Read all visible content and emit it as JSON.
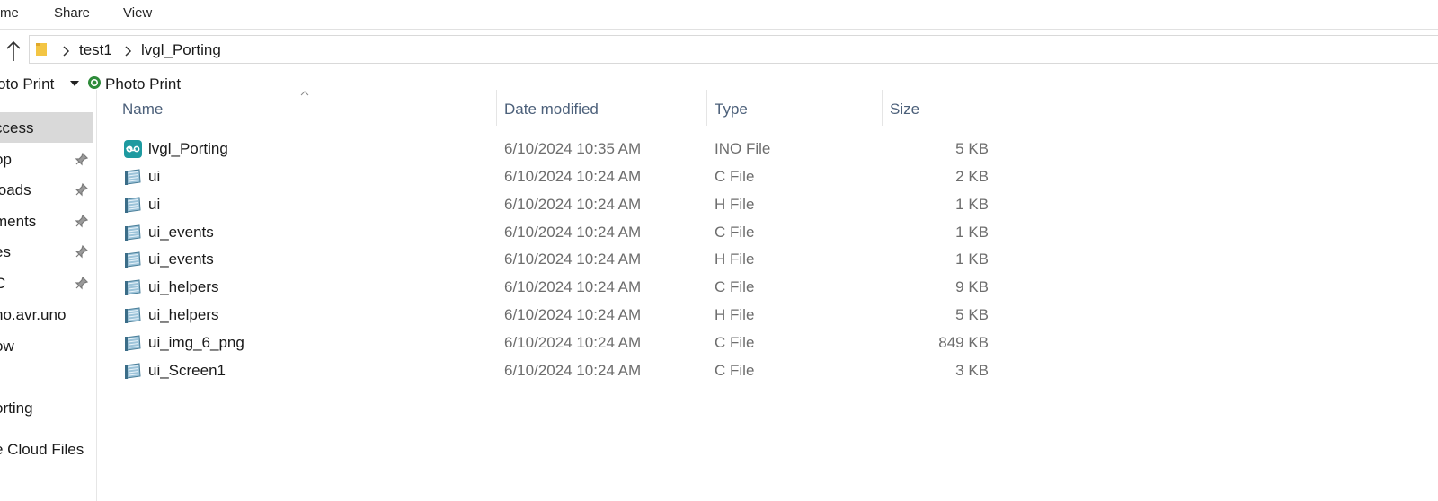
{
  "ribbon": {
    "tabs": [
      "me",
      "Share",
      "View"
    ]
  },
  "address": {
    "segments": [
      "test1",
      "lvgl_Porting"
    ]
  },
  "toolbar": {
    "item1": "oto Print",
    "item2": "Photo Print"
  },
  "nav": {
    "items": [
      {
        "label": "ccess",
        "pinned": false,
        "selected": true
      },
      {
        "label": "op",
        "pinned": true
      },
      {
        "label": "loads",
        "pinned": true
      },
      {
        "label": "ments",
        "pinned": true
      },
      {
        "label": "es",
        "pinned": true
      },
      {
        "label": "C",
        "pinned": true
      },
      {
        "label": "no.avr.uno",
        "pinned": false
      },
      {
        "label": "ow",
        "pinned": false
      },
      {
        "label": "orting",
        "pinned": false
      },
      {
        "label": "e Cloud Files",
        "pinned": false
      }
    ]
  },
  "columns": {
    "name": "Name",
    "date": "Date modified",
    "type": "Type",
    "size": "Size"
  },
  "files": [
    {
      "name": "lvgl_Porting",
      "date": "6/10/2024 10:35 AM",
      "type": "INO File",
      "size": "5 KB",
      "icon": "arduino-icon"
    },
    {
      "name": "ui",
      "date": "6/10/2024 10:24 AM",
      "type": "C File",
      "size": "2 KB",
      "icon": "source-file-icon"
    },
    {
      "name": "ui",
      "date": "6/10/2024 10:24 AM",
      "type": "H File",
      "size": "1 KB",
      "icon": "source-file-icon"
    },
    {
      "name": "ui_events",
      "date": "6/10/2024 10:24 AM",
      "type": "C File",
      "size": "1 KB",
      "icon": "source-file-icon"
    },
    {
      "name": "ui_events",
      "date": "6/10/2024 10:24 AM",
      "type": "H File",
      "size": "1 KB",
      "icon": "source-file-icon"
    },
    {
      "name": "ui_helpers",
      "date": "6/10/2024 10:24 AM",
      "type": "C File",
      "size": "9 KB",
      "icon": "source-file-icon"
    },
    {
      "name": "ui_helpers",
      "date": "6/10/2024 10:24 AM",
      "type": "H File",
      "size": "5 KB",
      "icon": "source-file-icon"
    },
    {
      "name": "ui_img_6_png",
      "date": "6/10/2024 10:24 AM",
      "type": "C File",
      "size": "849 KB",
      "icon": "source-file-icon"
    },
    {
      "name": "ui_Screen1",
      "date": "6/10/2024 10:24 AM",
      "type": "C File",
      "size": "3 KB",
      "icon": "source-file-icon"
    }
  ],
  "colors": {
    "selection": "#d9d9d9",
    "header_text": "#4c607a",
    "secondary_text": "#6d6d6d",
    "arduino": "#1e9aa0"
  }
}
